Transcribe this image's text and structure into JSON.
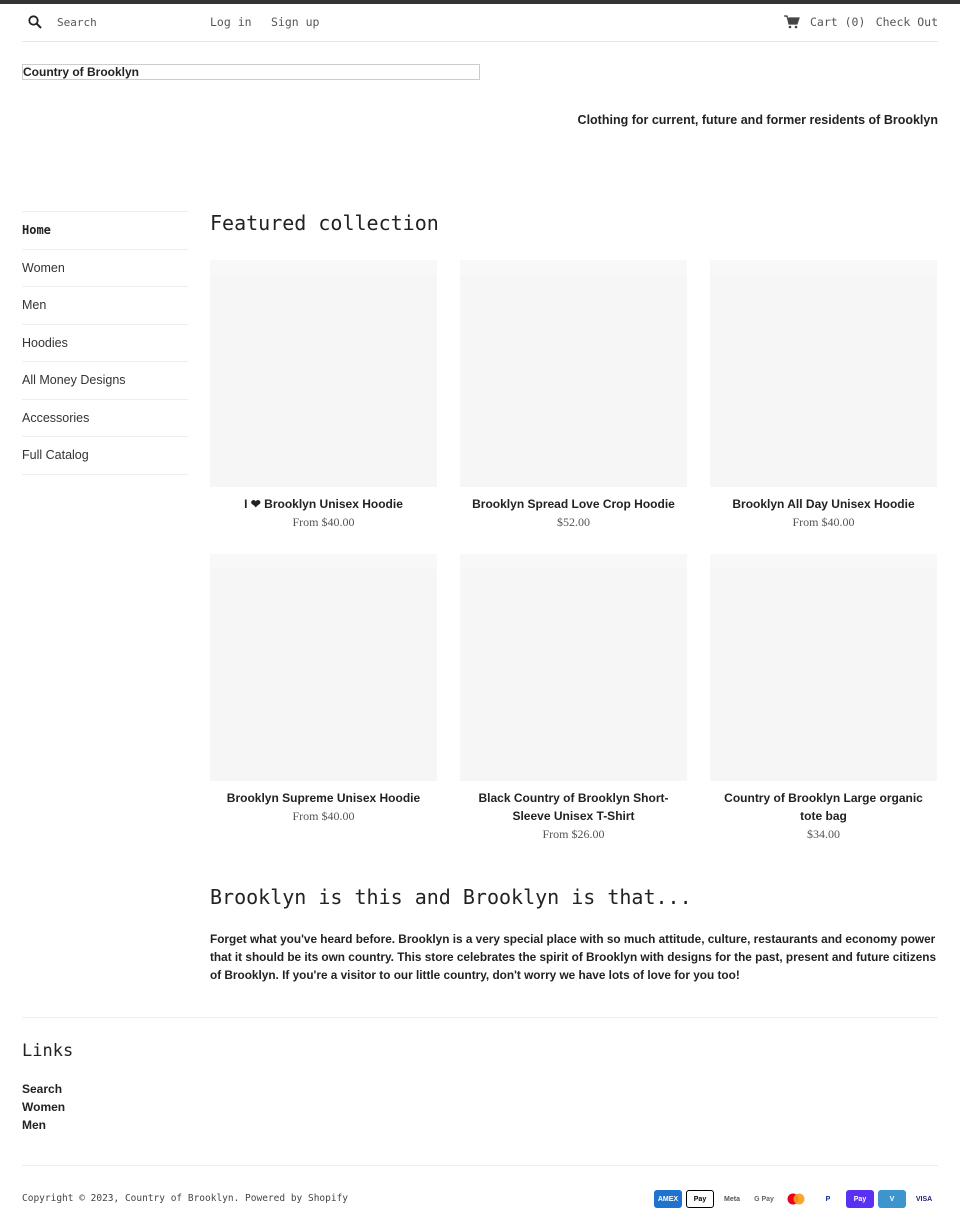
{
  "header": {
    "search_placeholder": "Search",
    "login": "Log in",
    "signup": "Sign up",
    "cart": "Cart (0)",
    "checkout": "Check Out"
  },
  "brand": {
    "name": "Country of Brooklyn",
    "tagline": "Clothing for current, future and former residents of Brooklyn"
  },
  "sidebar": {
    "items": [
      {
        "label": "Home",
        "active": true
      },
      {
        "label": "Women"
      },
      {
        "label": "Men"
      },
      {
        "label": "Hoodies"
      },
      {
        "label": "All Money Designs"
      },
      {
        "label": "Accessories"
      },
      {
        "label": "Full Catalog"
      }
    ]
  },
  "featured": {
    "heading": "Featured collection",
    "products": [
      {
        "title": "I ❤ Brooklyn Unisex Hoodie",
        "price": "From $40.00"
      },
      {
        "title": "Brooklyn Spread Love Crop Hoodie",
        "price": "$52.00"
      },
      {
        "title": "Brooklyn All Day Unisex Hoodie",
        "price": "From $40.00"
      },
      {
        "title": "Brooklyn Supreme Unisex Hoodie",
        "price": "From $40.00"
      },
      {
        "title": "Black Country of Brooklyn Short-Sleeve Unisex T-Shirt",
        "price": "From $26.00"
      },
      {
        "title": "Country of Brooklyn Large organic tote bag",
        "price": "$34.00"
      }
    ]
  },
  "about": {
    "heading": "Brooklyn is this and Brooklyn is that...",
    "body": "Forget what you've heard before. Brooklyn is a very special place with so much attitude, culture, restaurants and economy power that it should be its own country. This store celebrates the spirit of Brooklyn with designs for the past, present and future citizens of Brooklyn. If you're a visitor to our little country, don't worry we have lots of love for you too!"
  },
  "footer": {
    "links_heading": "Links",
    "links": [
      "Search",
      "Women",
      "Men"
    ],
    "copyright": "Copyright © 2023, Country of Brooklyn. Powered by Shopify",
    "payments": [
      {
        "name": "amex",
        "label": "AMEX",
        "bg": "#1f72cd",
        "fg": "#fff"
      },
      {
        "name": "apple-pay",
        "label": "Pay",
        "bg": "#fff",
        "fg": "#000",
        "border": "#000"
      },
      {
        "name": "meta-pay",
        "label": "Meta",
        "bg": "#fff",
        "fg": "#555"
      },
      {
        "name": "google-pay",
        "label": "G Pay",
        "bg": "#fff",
        "fg": "#666"
      },
      {
        "name": "mastercard",
        "label": "",
        "bg": "#fff",
        "fg": "#000"
      },
      {
        "name": "paypal",
        "label": "P",
        "bg": "#fff",
        "fg": "#003087"
      },
      {
        "name": "shop-pay",
        "label": "Pay",
        "bg": "#5a31f4",
        "fg": "#fff"
      },
      {
        "name": "venmo",
        "label": "V",
        "bg": "#3d95ce",
        "fg": "#fff"
      },
      {
        "name": "visa",
        "label": "VISA",
        "bg": "#fff",
        "fg": "#1a1f71"
      }
    ]
  }
}
